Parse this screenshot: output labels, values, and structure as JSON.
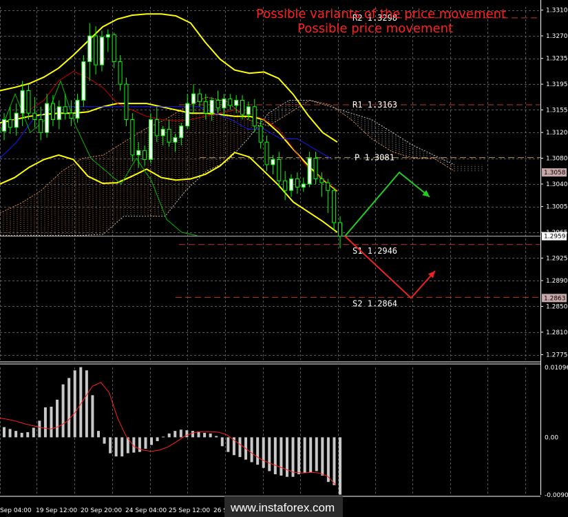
{
  "title_primary": "Possible variants of the price movement",
  "title_secondary": "Possible price movement",
  "watermark": "www.instaforex.com",
  "colors": {
    "background": "#000000",
    "grid": "#5a5a5a",
    "title": "#ff2020",
    "bull": "#00ff00",
    "bear": "#ff0000",
    "bollinger": "#ffff00",
    "middle_line": "#cc0000",
    "kijun": "#1a1aff",
    "chikou": "#00bb00",
    "cloud_a": "#e08a40",
    "cloud_b": "#c0c0c0",
    "level_line": "#c0392b",
    "osma_bar": "#c8c8c8",
    "signal": "#ff2020",
    "up_arrow": "#22cc22",
    "down_arrow": "#ee2222"
  },
  "chart_data": [
    {
      "type": "candlestick",
      "y_ticks": [
        "1.3310",
        "1.3270",
        "1.3235",
        "1.3195",
        "1.3155",
        "1.3120",
        "1.3080",
        "1.3040",
        "1.3005",
        "1.2965",
        "1.2925",
        "1.2890",
        "1.2850",
        "1.2810",
        "1.2775"
      ],
      "ylim": [
        1.2767,
        1.3315
      ],
      "x_ticks": [
        "Sep 04:00",
        "19 Sep 12:00",
        "20 Sep 20:00",
        "24 Sep 04:00",
        "25 Sep 12:00",
        "26 Se"
      ],
      "price_boxes": [
        "1.3058",
        "1.2959",
        "1.2863"
      ],
      "levels": [
        {
          "label": "R2 1.3298",
          "value": 1.3298
        },
        {
          "label": "R1 1.3163",
          "value": 1.3163
        },
        {
          "label": "P 1.3081",
          "value": 1.3081
        },
        {
          "label": "S1 1.2946",
          "value": 1.2946
        },
        {
          "label": "S2 1.2864",
          "value": 1.2864
        }
      ],
      "candles": [
        [
          1.3122,
          1.315,
          1.3108,
          1.314
        ],
        [
          1.314,
          1.316,
          1.3118,
          1.3128
        ],
        [
          1.3128,
          1.3165,
          1.3115,
          1.315
        ],
        [
          1.315,
          1.32,
          1.313,
          1.3185
        ],
        [
          1.3185,
          1.3195,
          1.314,
          1.315
        ],
        [
          1.315,
          1.3175,
          1.3128,
          1.314
        ],
        [
          1.314,
          1.316,
          1.3108,
          1.312
        ],
        [
          1.312,
          1.318,
          1.3112,
          1.3165
        ],
        [
          1.3165,
          1.3178,
          1.313,
          1.314
        ],
        [
          1.314,
          1.317,
          1.3125,
          1.316
        ],
        [
          1.316,
          1.318,
          1.314,
          1.315
        ],
        [
          1.315,
          1.317,
          1.313,
          1.3142
        ],
        [
          1.3142,
          1.318,
          1.3135,
          1.317
        ],
        [
          1.317,
          1.324,
          1.316,
          1.323
        ],
        [
          1.323,
          1.329,
          1.32,
          1.327
        ],
        [
          1.327,
          1.3285,
          1.321,
          1.3225
        ],
        [
          1.3225,
          1.3278,
          1.3215,
          1.3268
        ],
        [
          1.3268,
          1.328,
          1.3245,
          1.3272
        ],
        [
          1.3272,
          1.3275,
          1.322,
          1.323
        ],
        [
          1.323,
          1.324,
          1.3185,
          1.3195
        ],
        [
          1.3195,
          1.3205,
          1.313,
          1.314
        ],
        [
          1.314,
          1.315,
          1.3075,
          1.3085
        ],
        [
          1.3085,
          1.3105,
          1.3065,
          1.3092
        ],
        [
          1.3092,
          1.31,
          1.3068,
          1.3078
        ],
        [
          1.3078,
          1.315,
          1.3072,
          1.314
        ],
        [
          1.314,
          1.316,
          1.3105,
          1.3115
        ],
        [
          1.3115,
          1.313,
          1.31,
          1.3125
        ],
        [
          1.3125,
          1.314,
          1.3098,
          1.3105
        ],
        [
          1.3105,
          1.3118,
          1.309,
          1.3112
        ],
        [
          1.3112,
          1.3135,
          1.31,
          1.313
        ],
        [
          1.313,
          1.318,
          1.3125,
          1.3165
        ],
        [
          1.3165,
          1.3195,
          1.315,
          1.318
        ],
        [
          1.318,
          1.3188,
          1.316,
          1.3168
        ],
        [
          1.3168,
          1.318,
          1.314,
          1.315
        ],
        [
          1.315,
          1.3175,
          1.3138,
          1.317
        ],
        [
          1.317,
          1.3185,
          1.315,
          1.3158
        ],
        [
          1.3158,
          1.318,
          1.3145,
          1.3172
        ],
        [
          1.3172,
          1.318,
          1.3155,
          1.3162
        ],
        [
          1.3162,
          1.3178,
          1.315,
          1.317
        ],
        [
          1.317,
          1.3178,
          1.314,
          1.3148
        ],
        [
          1.3148,
          1.3168,
          1.314,
          1.316
        ],
        [
          1.316,
          1.3172,
          1.312,
          1.313
        ],
        [
          1.313,
          1.314,
          1.3095,
          1.3105
        ],
        [
          1.3105,
          1.3115,
          1.306,
          1.307
        ],
        [
          1.307,
          1.3085,
          1.3055,
          1.3078
        ],
        [
          1.3078,
          1.309,
          1.3035,
          1.3045
        ],
        [
          1.3045,
          1.306,
          1.3015,
          1.303
        ],
        [
          1.303,
          1.3055,
          1.302,
          1.3048
        ],
        [
          1.3048,
          1.3058,
          1.3025,
          1.3035
        ],
        [
          1.3035,
          1.305,
          1.3028,
          1.304
        ],
        [
          1.304,
          1.309,
          1.3035,
          1.308
        ],
        [
          1.308,
          1.309,
          1.304,
          1.3048
        ],
        [
          1.3048,
          1.3058,
          1.302,
          1.3042
        ],
        [
          1.3042,
          1.3048,
          1.2995,
          1.303
        ],
        [
          1.303,
          1.3035,
          1.2968,
          1.298
        ],
        [
          1.298,
          1.299,
          1.294,
          1.2959
        ]
      ],
      "bollinger_upper": [
        1.3185,
        1.319,
        1.3196,
        1.3206,
        1.322,
        1.324,
        1.3262,
        1.3284,
        1.3296,
        1.3302,
        1.3304,
        1.3304,
        1.3301,
        1.329,
        1.326,
        1.3234,
        1.3217,
        1.3212,
        1.3214,
        1.3204,
        1.3179,
        1.3147,
        1.312,
        1.3105
      ],
      "bollinger_middle": [
        1.3135,
        1.314,
        1.3145,
        1.3148,
        1.315,
        1.315,
        1.3152,
        1.316,
        1.3165,
        1.3165,
        1.3165,
        1.316,
        1.3155,
        1.315,
        1.315,
        1.3148,
        1.3145,
        1.3145,
        1.314,
        1.312,
        1.3094,
        1.3069,
        1.3047,
        1.3029
      ],
      "bollinger_lower": [
        1.304,
        1.305,
        1.3066,
        1.3078,
        1.3085,
        1.3078,
        1.3052,
        1.3041,
        1.3042,
        1.3052,
        1.3063,
        1.305,
        1.3046,
        1.3048,
        1.3055,
        1.3068,
        1.3089,
        1.3082,
        1.306,
        1.3038,
        1.3012,
        1.2997,
        1.2982,
        1.2965
      ],
      "middle_line": [
        1.313,
        1.314,
        1.3155,
        1.317,
        1.32,
        1.3215,
        1.3205,
        1.319,
        1.3165,
        1.3155,
        1.3145,
        1.314,
        1.3138,
        1.314,
        1.3145,
        1.315,
        1.3155,
        1.315,
        1.314,
        1.3125,
        1.3095,
        1.3065,
        1.3048,
        1.303
      ],
      "kijun": [
        1.308,
        1.3105,
        1.314,
        1.3155,
        1.316,
        1.316,
        1.316,
        1.316,
        1.316,
        1.316,
        1.316,
        1.316,
        1.316,
        1.315,
        1.314,
        1.3125,
        1.3125,
        1.311,
        1.311,
        1.3095,
        1.308
      ],
      "chikou": [
        1.312,
        1.318,
        1.312,
        1.314,
        1.32,
        1.313,
        1.308,
        1.306,
        1.304,
        1.308,
        1.3045,
        1.2985,
        1.2965,
        1.296
      ],
      "cloud_span_a": [
        1.2995,
        1.301,
        1.303,
        1.306,
        1.308,
        1.3085,
        1.3105,
        1.3125,
        1.314,
        1.316,
        1.3175,
        1.3168,
        1.314,
        1.313,
        1.315,
        1.317,
        1.3163,
        1.314,
        1.311,
        1.309,
        1.308,
        1.308,
        1.306
      ],
      "cloud_span_b": [
        1.296,
        1.296,
        1.296,
        1.296,
        1.296,
        1.2962,
        1.299,
        1.299,
        1.299,
        1.303,
        1.306,
        1.3075,
        1.311,
        1.315,
        1.317,
        1.317,
        1.316,
        1.315,
        1.314,
        1.312,
        1.31,
        1.3085,
        1.307
      ],
      "scenario_up": [
        1.2959,
        1.3058,
        1.302
      ],
      "scenario_down": [
        1.2959,
        1.2863,
        1.2905
      ]
    },
    {
      "type": "bar",
      "y_ticks": [
        "0.01096",
        "0.00",
        "-0.00904"
      ],
      "ylim": [
        -0.00904,
        0.01096
      ],
      "histogram": [
        0.0016,
        0.0013,
        0.001,
        0.0007,
        0.0008,
        0.0015,
        0.0026,
        0.0047,
        0.0048,
        0.0059,
        0.0083,
        0.0093,
        0.0105,
        0.011,
        0.0105,
        0.0066,
        0.001,
        -0.001,
        -0.0025,
        -0.003,
        -0.003,
        -0.0025,
        -0.0024,
        -0.0023,
        -0.0018,
        -0.0012,
        -0.0006,
        0.0001,
        0.0006,
        0.001,
        0.0012,
        0.0011,
        0.001,
        0.0009,
        0.0007,
        0.0006,
        0.0002,
        -0.0014,
        -0.0023,
        -0.0028,
        -0.0031,
        -0.0035,
        -0.0039,
        -0.0043,
        -0.0048,
        -0.0053,
        -0.0058,
        -0.006,
        -0.0062,
        -0.0062,
        -0.0058,
        -0.0056,
        -0.0055,
        -0.0053,
        -0.006,
        -0.007,
        -0.0075,
        -0.009
      ],
      "signal": [
        0.003,
        0.0028,
        0.0025,
        0.0021,
        0.0018,
        0.0015,
        0.0013,
        0.0017,
        0.0025,
        0.004,
        0.006,
        0.008,
        0.0086,
        0.007,
        0.003,
        0.0002,
        -0.0015,
        -0.002,
        -0.0022,
        -0.002,
        -0.0015,
        -0.0007,
        0.0002,
        0.0007,
        0.0009,
        0.0009,
        0.0008,
        0.0004,
        -0.0006,
        -0.0015,
        -0.0025,
        -0.0034,
        -0.004,
        -0.0045,
        -0.005,
        -0.0055,
        -0.0056,
        -0.0055,
        -0.0056,
        -0.0061,
        -0.0075
      ]
    }
  ]
}
